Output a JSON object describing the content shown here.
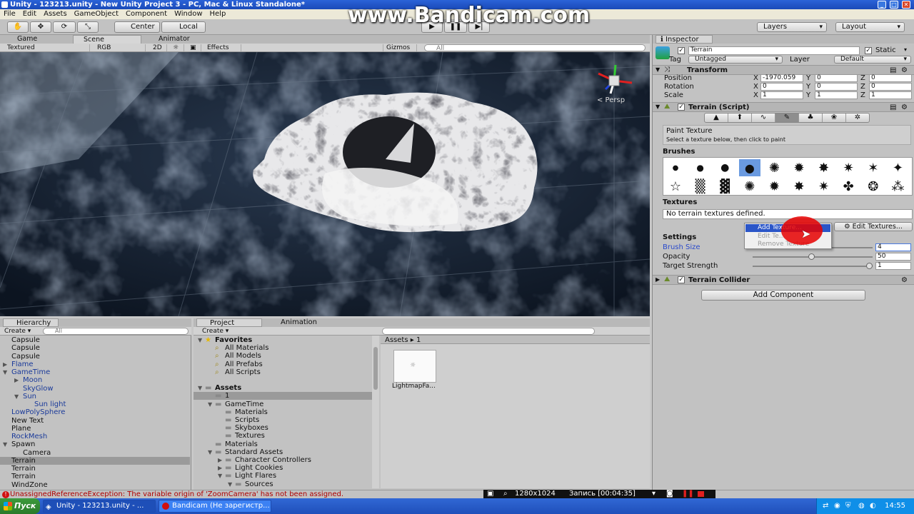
{
  "window": {
    "title": "Unity - 123213.unity - New Unity Project 3 - PC, Mac & Linux Standalone*"
  },
  "watermark": "www.Bandicam.com",
  "menu": [
    "File",
    "Edit",
    "Assets",
    "GameObject",
    "Component",
    "Window",
    "Help"
  ],
  "toolbar": {
    "pivot": "Center",
    "space": "Local",
    "layers": "Layers",
    "layout": "Layout"
  },
  "scene_tabs": {
    "game": "Game",
    "scene": "Scene",
    "animator": "Animator"
  },
  "scene_toolbar": {
    "render_mode": "Textured",
    "color": "RGB",
    "mode2d": "2D",
    "effects": "Effects",
    "gizmos": "Gizmos",
    "search": "All"
  },
  "gizmo": {
    "persp": "< Persp"
  },
  "inspector": {
    "tab": "Inspector",
    "object_name": "Terrain",
    "static": "Static",
    "tag_label": "Tag",
    "tag_value": "Untagged",
    "layer_label": "Layer",
    "layer_value": "Default",
    "transform": {
      "title": "Transform",
      "position_label": "Position",
      "pos_x": "-1970.059",
      "pos_y": "0",
      "pos_z": "0",
      "rotation_label": "Rotation",
      "rot_x": "0",
      "rot_y": "0",
      "rot_z": "0",
      "scale_label": "Scale",
      "scl_x": "1",
      "scl_y": "1",
      "scl_z": "1",
      "x": "X",
      "y": "Y",
      "z": "Z"
    },
    "terrain_script": {
      "title": "Terrain (Script)",
      "paint_title": "Paint Texture",
      "paint_hint": "Select a texture below, then click to paint",
      "brushes_label": "Brushes",
      "textures_label": "Textures",
      "no_textures": "No terrain textures defined.",
      "edit_textures": "Edit Textures...",
      "settings_label": "Settings",
      "brush_size_label": "Brush Size",
      "brush_size": "4",
      "opacity_label": "Opacity",
      "opacity": "50",
      "target_strength_label": "Target Strength",
      "target_strength": "1"
    },
    "popup": {
      "add": "Add Texture...",
      "edit": "Edit Te...",
      "remove": "Remove Texture"
    },
    "collider": "Terrain Collider",
    "add_component": "Add Component"
  },
  "hierarchy": {
    "tab": "Hierarchy",
    "create": "Create",
    "search": "All",
    "items": [
      {
        "label": "Capsule",
        "indent": 0,
        "arrow": "",
        "blue": false,
        "selected": false
      },
      {
        "label": "Capsule",
        "indent": 0,
        "arrow": "",
        "blue": false,
        "selected": false
      },
      {
        "label": "Capsule",
        "indent": 0,
        "arrow": "",
        "blue": false,
        "selected": false
      },
      {
        "label": "Flame",
        "indent": 0,
        "arrow": "right",
        "blue": true,
        "selected": false
      },
      {
        "label": "GameTime",
        "indent": 0,
        "arrow": "down",
        "blue": true,
        "selected": false
      },
      {
        "label": "Moon",
        "indent": 1,
        "arrow": "right",
        "blue": true,
        "selected": false
      },
      {
        "label": "SkyGlow",
        "indent": 1,
        "arrow": "",
        "blue": true,
        "selected": false
      },
      {
        "label": "Sun",
        "indent": 1,
        "arrow": "down",
        "blue": true,
        "selected": false
      },
      {
        "label": "Sun light",
        "indent": 2,
        "arrow": "",
        "blue": true,
        "selected": false
      },
      {
        "label": "LowPolySphere",
        "indent": 0,
        "arrow": "",
        "blue": true,
        "selected": false
      },
      {
        "label": "New Text",
        "indent": 0,
        "arrow": "",
        "blue": false,
        "selected": false
      },
      {
        "label": "Plane",
        "indent": 0,
        "arrow": "",
        "blue": false,
        "selected": false
      },
      {
        "label": "RockMesh",
        "indent": 0,
        "arrow": "",
        "blue": true,
        "selected": false
      },
      {
        "label": "Spawn",
        "indent": 0,
        "arrow": "down",
        "blue": false,
        "selected": false
      },
      {
        "label": "Camera",
        "indent": 1,
        "arrow": "",
        "blue": false,
        "selected": false
      },
      {
        "label": "Terrain",
        "indent": 0,
        "arrow": "",
        "blue": false,
        "selected": true
      },
      {
        "label": "Terrain",
        "indent": 0,
        "arrow": "",
        "blue": false,
        "selected": false
      },
      {
        "label": "Terrain",
        "indent": 0,
        "arrow": "",
        "blue": false,
        "selected": false
      },
      {
        "label": "WindZone",
        "indent": 0,
        "arrow": "",
        "blue": false,
        "selected": false
      }
    ]
  },
  "project": {
    "tab": "Project",
    "animation_tab": "Animation",
    "create": "Create",
    "breadcrumb_root": "Assets",
    "breadcrumb_sep": "▸",
    "breadcrumb_child": "1",
    "asset_name": "LightmapFa...",
    "tree": [
      {
        "label": "Favorites",
        "indent": 0,
        "arrow": "down",
        "icon": "star",
        "bold": true,
        "selected": false
      },
      {
        "label": "All Materials",
        "indent": 1,
        "arrow": "",
        "icon": "search",
        "bold": false,
        "selected": false
      },
      {
        "label": "All Models",
        "indent": 1,
        "arrow": "",
        "icon": "search",
        "bold": false,
        "selected": false
      },
      {
        "label": "All Prefabs",
        "indent": 1,
        "arrow": "",
        "icon": "search",
        "bold": false,
        "selected": false
      },
      {
        "label": "All Scripts",
        "indent": 1,
        "arrow": "",
        "icon": "search",
        "bold": false,
        "selected": false
      },
      {
        "label": "",
        "indent": 0,
        "arrow": "",
        "icon": "",
        "bold": false,
        "selected": false
      },
      {
        "label": "Assets",
        "indent": 0,
        "arrow": "down",
        "icon": "folder",
        "bold": true,
        "selected": false
      },
      {
        "label": "1",
        "indent": 1,
        "arrow": "",
        "icon": "folder",
        "bold": false,
        "selected": true
      },
      {
        "label": "GameTime",
        "indent": 1,
        "arrow": "down",
        "icon": "folder",
        "bold": false,
        "selected": false
      },
      {
        "label": "Materials",
        "indent": 2,
        "arrow": "",
        "icon": "folder",
        "bold": false,
        "selected": false
      },
      {
        "label": "Scripts",
        "indent": 2,
        "arrow": "",
        "icon": "folder",
        "bold": false,
        "selected": false
      },
      {
        "label": "Skyboxes",
        "indent": 2,
        "arrow": "",
        "icon": "folder",
        "bold": false,
        "selected": false
      },
      {
        "label": "Textures",
        "indent": 2,
        "arrow": "",
        "icon": "folder",
        "bold": false,
        "selected": false
      },
      {
        "label": "Materials",
        "indent": 1,
        "arrow": "",
        "icon": "folder",
        "bold": false,
        "selected": false
      },
      {
        "label": "Standard Assets",
        "indent": 1,
        "arrow": "down",
        "icon": "folder",
        "bold": false,
        "selected": false
      },
      {
        "label": "Character Controllers",
        "indent": 2,
        "arrow": "right",
        "icon": "folder",
        "bold": false,
        "selected": false
      },
      {
        "label": "Light Cookies",
        "indent": 2,
        "arrow": "right",
        "icon": "folder",
        "bold": false,
        "selected": false
      },
      {
        "label": "Light Flares",
        "indent": 2,
        "arrow": "down",
        "icon": "folder",
        "bold": false,
        "selected": false
      },
      {
        "label": "Sources",
        "indent": 3,
        "arrow": "down",
        "icon": "folder",
        "bold": false,
        "selected": false
      }
    ]
  },
  "status": {
    "message": "UnassignedReferenceException: The variable origin of 'ZoomCamera' has not been assigned."
  },
  "recorder": {
    "resolution": "1280x1024",
    "recording": "Запись [00:04:35]"
  },
  "taskbar": {
    "start": "Пуск",
    "tasks": [
      "Unity - 123213.unity - ...",
      "Bandicam (Не зарегистр..."
    ],
    "clock": "14:55"
  },
  "colors": {
    "accent_blue": "#1a3a9a",
    "error_red": "#b00000",
    "selection": "#9a9a9a",
    "xp_blue": "#2458c8"
  }
}
